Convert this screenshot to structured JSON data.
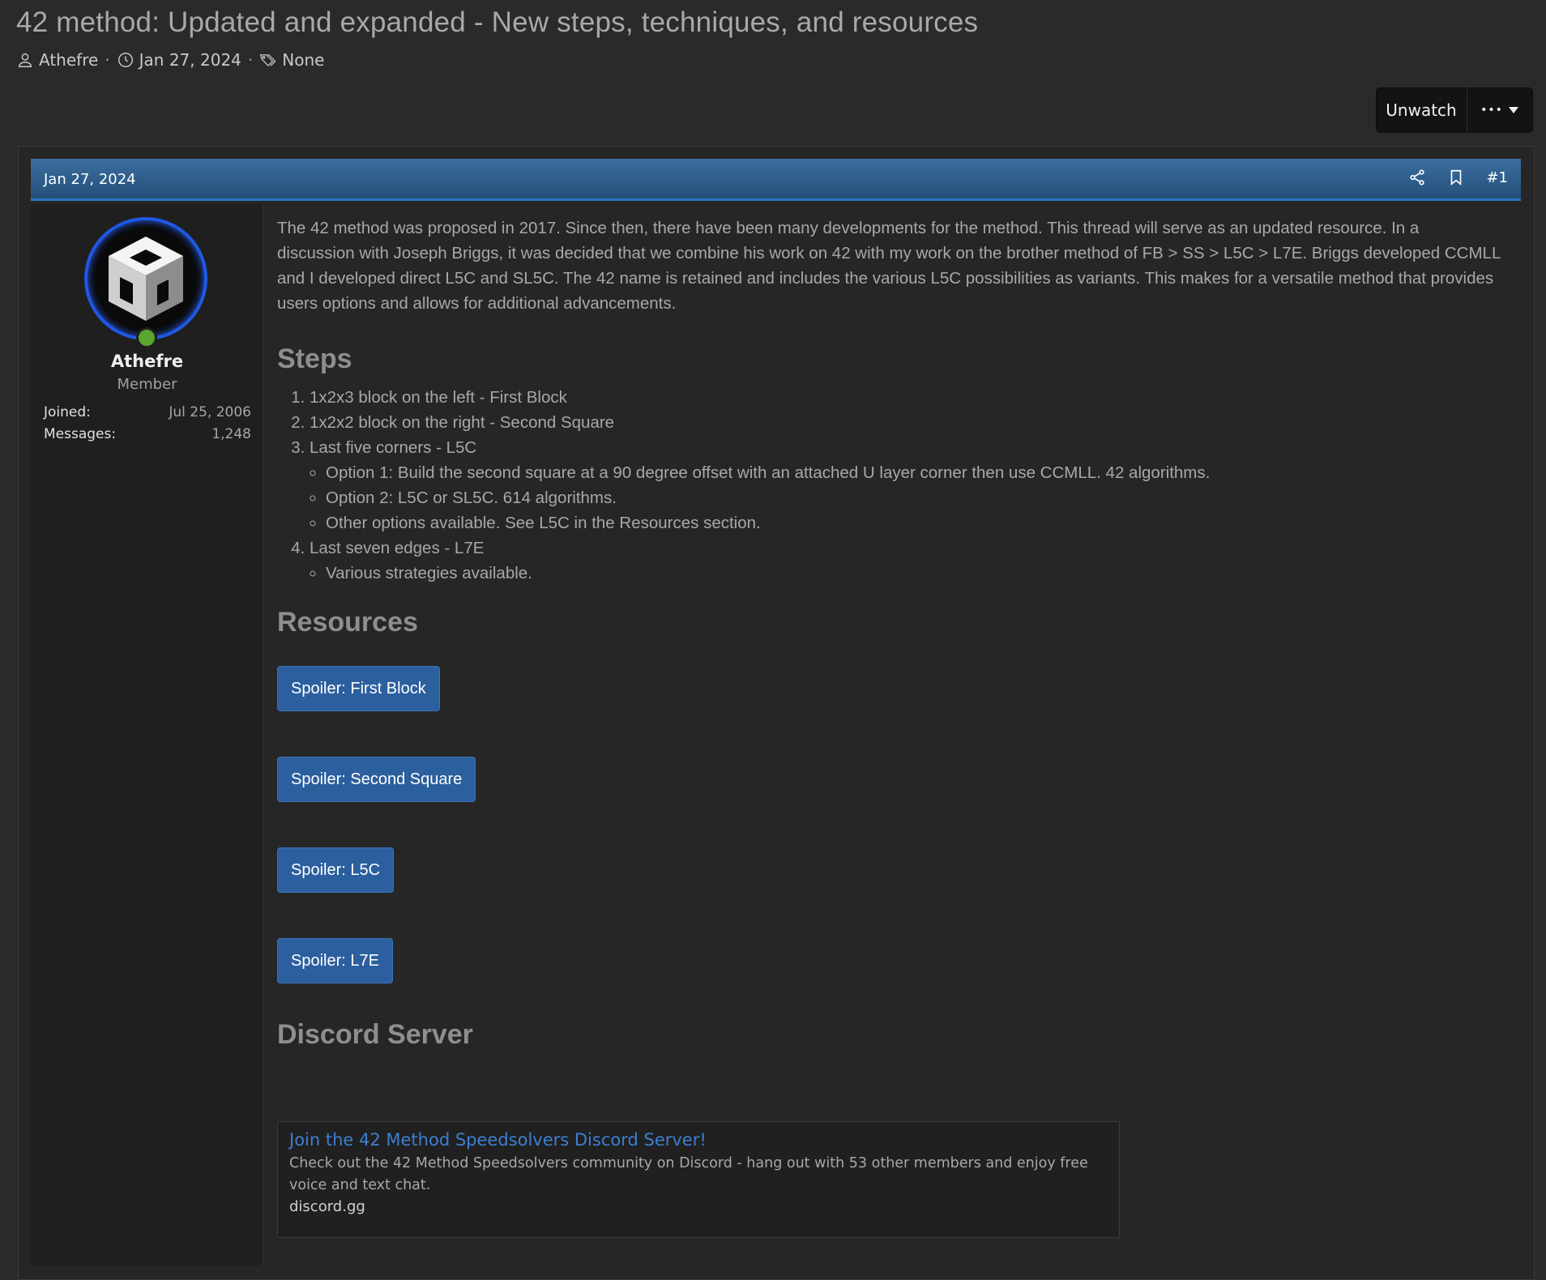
{
  "thread": {
    "title": "42 method: Updated and expanded - New steps, techniques, and resources",
    "author": "Athefre",
    "date": "Jan 27, 2024",
    "tags": "None"
  },
  "actions": {
    "unwatch_label": "Unwatch",
    "more_label": "•••"
  },
  "post": {
    "date": "Jan 27, 2024",
    "number": "#1"
  },
  "user": {
    "name": "Athefre",
    "title": "Member",
    "joined_label": "Joined:",
    "joined_value": "Jul 25, 2006",
    "messages_label": "Messages:",
    "messages_value": "1,248"
  },
  "body": {
    "intro": "The 42 method was proposed in 2017. Since then, there have been many developments for the method. This thread will serve as an updated resource. In a discussion with Joseph Briggs, it was decided that we combine his work on 42 with my work on the brother method of FB > SS > L5C > L7E. Briggs developed CCMLL and I developed direct L5C and SL5C. The 42 name is retained and includes the various L5C possibilities as variants. This makes for a versatile method that provides users options and allows for additional advancements.",
    "steps_heading": "Steps",
    "steps": [
      "1x2x3 block on the left - First Block",
      "1x2x2 block on the right - Second Square",
      "Last five corners - L5C",
      "Last seven edges - L7E"
    ],
    "step3_options": [
      "Option 1: Build the second square at a 90 degree offset with an attached U layer corner then use CCMLL. 42 algorithms.",
      "Option 2: L5C or SL5C. 614 algorithms.",
      "Other options available. See L5C in the Resources section."
    ],
    "step4_options": [
      "Various strategies available."
    ],
    "resources_heading": "Resources",
    "spoilers": [
      "Spoiler: First Block",
      "Spoiler: Second Square",
      "Spoiler: L5C",
      "Spoiler: L7E"
    ],
    "discord_heading": "Discord Server"
  },
  "embed": {
    "title": "Join the 42 Method Speedsolvers Discord Server!",
    "description": "Check out the 42 Method Speedsolvers community on Discord - hang out with 53 other members and enjoy free voice and text chat.",
    "domain": "discord.gg"
  },
  "colors": {
    "header_blue": "#2f6199",
    "spoiler_blue": "#2c5f9e",
    "link_blue": "#3d7fd1",
    "online_green": "#5aa62e"
  }
}
